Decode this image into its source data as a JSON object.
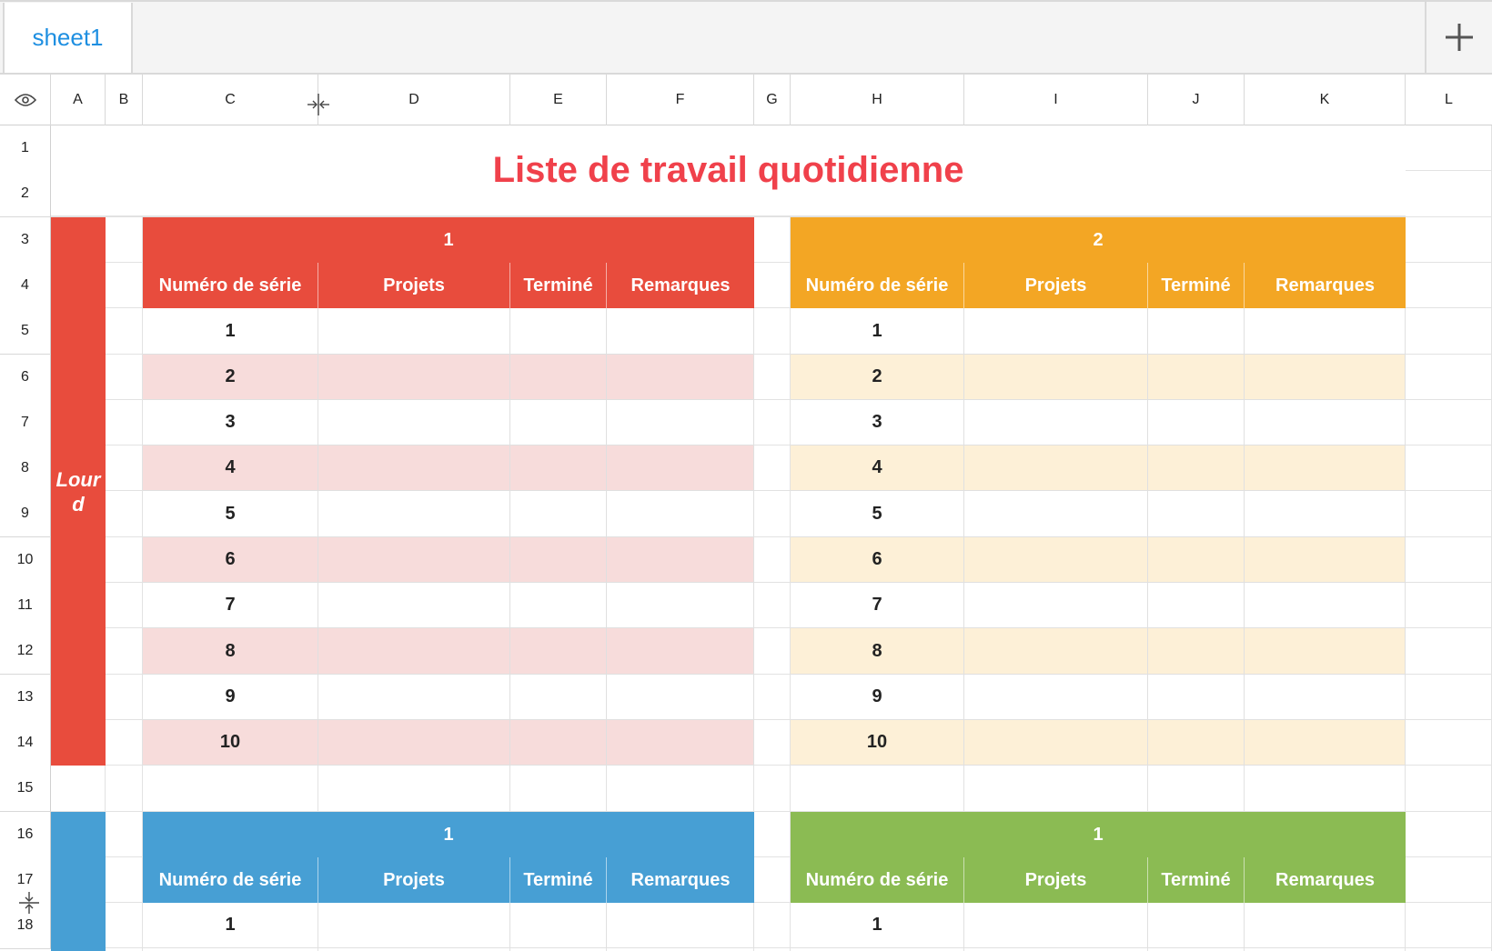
{
  "tabs": {
    "active": "sheet1",
    "add_label": "+"
  },
  "columns": [
    "A",
    "B",
    "C",
    "D",
    "E",
    "F",
    "G",
    "H",
    "I",
    "J",
    "K",
    "L"
  ],
  "rows": [
    "1",
    "2",
    "3",
    "4",
    "5",
    "6",
    "7",
    "8",
    "9",
    "10",
    "11",
    "12",
    "13",
    "14",
    "15",
    "16",
    "17",
    "18"
  ],
  "title": "Liste de travail quotidienne",
  "side_label": "Lour d",
  "tables": [
    {
      "title": "1",
      "color": "#e84c3d",
      "stripe": "#f7dcdb",
      "headers": [
        "Numéro de série",
        "Projets",
        "Terminé",
        "Remarques"
      ],
      "serials": [
        "1",
        "2",
        "3",
        "4",
        "5",
        "6",
        "7",
        "8",
        "9",
        "10"
      ]
    },
    {
      "title": "2",
      "color": "#f3a624",
      "stripe": "#fdf0d7",
      "headers": [
        "Numéro de série",
        "Projets",
        "Terminé",
        "Remarques"
      ],
      "serials": [
        "1",
        "2",
        "3",
        "4",
        "5",
        "6",
        "7",
        "8",
        "9",
        "10"
      ]
    },
    {
      "title": "1",
      "color": "#479fd4",
      "headers": [
        "Numéro de série",
        "Projets",
        "Terminé",
        "Remarques"
      ],
      "serials": [
        "1"
      ]
    },
    {
      "title": "1",
      "color": "#8bbb53",
      "headers": [
        "Numéro de série",
        "Projets",
        "Terminé",
        "Remarques"
      ],
      "serials": [
        "1"
      ]
    }
  ],
  "colors": {
    "title": "#f0414b",
    "accent_red": "#e84c3d",
    "accent_blue": "#479fd4"
  },
  "icons": [
    "eye-icon",
    "plus-icon",
    "column-resize-icon",
    "row-resize-icon"
  ]
}
